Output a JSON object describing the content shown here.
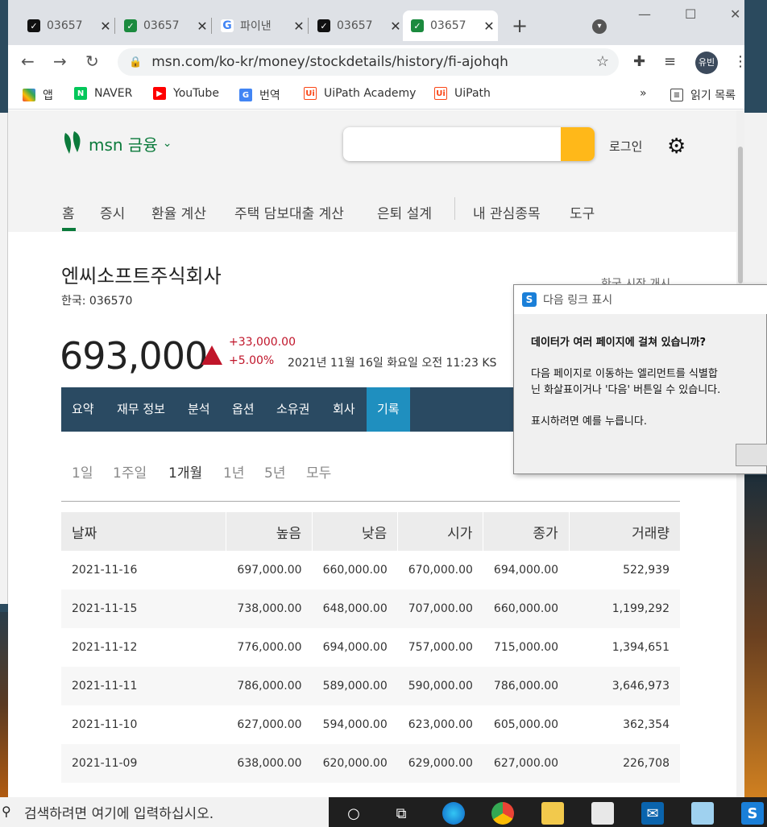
{
  "browser": {
    "tabs": [
      {
        "title": "03657",
        "favicon": "msn-icon",
        "color": "#111111"
      },
      {
        "title": "03657",
        "favicon": "msn-green-icon",
        "color": "#1b8a3e"
      },
      {
        "title": "파이낸",
        "favicon": "google-icon",
        "color": "#4285f4"
      },
      {
        "title": "03657",
        "favicon": "msn-icon",
        "color": "#111111"
      },
      {
        "title": "03657",
        "favicon": "msn-green-icon",
        "color": "#1b8a3e"
      }
    ],
    "url": "msn.com/ko-kr/money/stockdetails/history/fi-ajohqh",
    "avatar": "유빈",
    "bookmarks": [
      {
        "label": "앱",
        "icon": "apps-grid-icon"
      },
      {
        "label": "NAVER",
        "icon": "naver-icon"
      },
      {
        "label": "YouTube",
        "icon": "youtube-icon"
      },
      {
        "label": "번역",
        "icon": "translate-icon"
      },
      {
        "label": "UiPath Academy",
        "icon": "uipath-icon"
      },
      {
        "label": "UiPath",
        "icon": "uipath-icon"
      }
    ],
    "bookmarks_more": "»",
    "reading_list": "읽기 목록"
  },
  "site": {
    "logo_text": "msn 금융",
    "login": "로그인",
    "nav": [
      "홈",
      "증시",
      "환율 계산",
      "주택 담보대출 계산",
      "은퇴 설계",
      "내 관심종목",
      "도구"
    ]
  },
  "stock": {
    "name": "엔씨소프트주식회사",
    "ticker": "한국: 036570",
    "price": "693,000",
    "change_abs": "+33,000.00",
    "change_pct": "+5.00%",
    "timestamp": "2021년 11월 16일 화요일 오전 11:23 KS",
    "market_link": "한국 시장 개시",
    "up_color": "#c0152a"
  },
  "subnav": [
    "요약",
    "재무 정보",
    "분석",
    "옵션",
    "소유권",
    "회사",
    "기록"
  ],
  "ranges": [
    "1일",
    "1주일",
    "1개월",
    "1년",
    "5년",
    "모두"
  ],
  "table": {
    "headers": [
      "날짜",
      "높음",
      "낮음",
      "시가",
      "종가",
      "거래량"
    ],
    "rows": [
      [
        "2021-11-16",
        "697,000.00",
        "660,000.00",
        "670,000.00",
        "694,000.00",
        "522,939"
      ],
      [
        "2021-11-15",
        "738,000.00",
        "648,000.00",
        "707,000.00",
        "660,000.00",
        "1,199,292"
      ],
      [
        "2021-11-12",
        "776,000.00",
        "694,000.00",
        "757,000.00",
        "715,000.00",
        "1,394,651"
      ],
      [
        "2021-11-11",
        "786,000.00",
        "589,000.00",
        "590,000.00",
        "786,000.00",
        "3,646,973"
      ],
      [
        "2021-11-10",
        "627,000.00",
        "594,000.00",
        "623,000.00",
        "605,000.00",
        "362,354"
      ],
      [
        "2021-11-09",
        "638,000.00",
        "620,000.00",
        "629,000.00",
        "627,000.00",
        "226,708"
      ]
    ]
  },
  "dialog": {
    "title": "다음 링크 표시",
    "question": "데이터가 여러 페이지에 걸쳐 있습니까?",
    "line1": "다음 페이지로 이동하는 엘리먼트를 식별합",
    "line2": "닌 화살표이거나 '다음' 버튼일 수 있습니다.",
    "line3": "표시하려면 예를 누릅니다."
  },
  "taskbar": {
    "search_placeholder": "검색하려면 여기에 입력하십시오.",
    "apps": [
      "cortana-icon",
      "task-view-icon",
      "edge-icon",
      "chrome-icon",
      "file-explorer-icon",
      "store-icon",
      "mail-icon",
      "notepad-icon",
      "uipath-assistant-icon"
    ]
  }
}
